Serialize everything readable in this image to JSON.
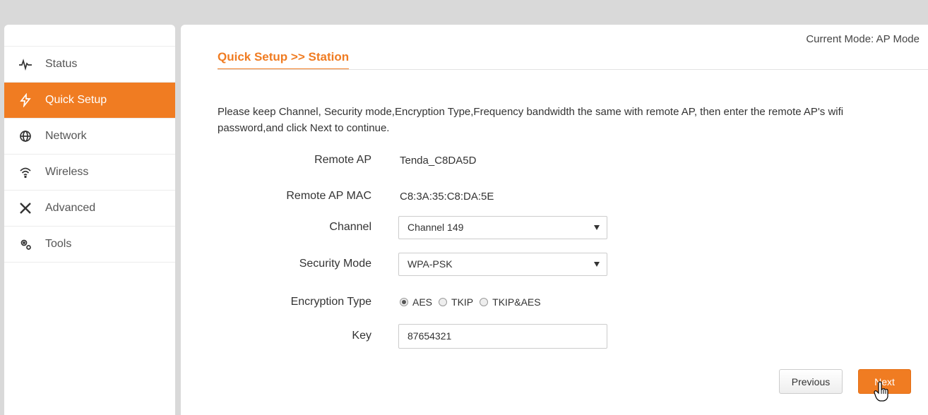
{
  "sidebar": {
    "items": [
      {
        "label": "Status",
        "icon": "pulse-icon"
      },
      {
        "label": "Quick Setup",
        "icon": "bolt-icon",
        "active": true
      },
      {
        "label": "Network",
        "icon": "globe-icon"
      },
      {
        "label": "Wireless",
        "icon": "wifi-icon"
      },
      {
        "label": "Advanced",
        "icon": "tools-icon"
      },
      {
        "label": "Tools",
        "icon": "gears-icon"
      }
    ]
  },
  "header": {
    "mode_text": "Current Mode: AP Mode",
    "title": "Quick Setup >>  Station"
  },
  "description": "Please keep Channel, Security mode,Encryption Type,Frequency bandwidth the same with remote AP, then enter the remote AP's wifi password,and click Next to continue.",
  "form": {
    "remote_ap": {
      "label": "Remote AP",
      "value": "Tenda_C8DA5D"
    },
    "remote_ap_mac": {
      "label": "Remote AP MAC",
      "value": "C8:3A:35:C8:DA:5E"
    },
    "channel": {
      "label": "Channel",
      "value": "Channel 149"
    },
    "security_mode": {
      "label": "Security Mode",
      "value": "WPA-PSK"
    },
    "encryption_type": {
      "label": "Encryption Type",
      "options": [
        "AES",
        "TKIP",
        "TKIP&AES"
      ],
      "selected": "AES"
    },
    "key": {
      "label": "Key",
      "value": "87654321"
    }
  },
  "buttons": {
    "previous": "Previous",
    "next": "Next"
  },
  "colors": {
    "accent": "#f07c22",
    "background": "#d9d9d9"
  }
}
